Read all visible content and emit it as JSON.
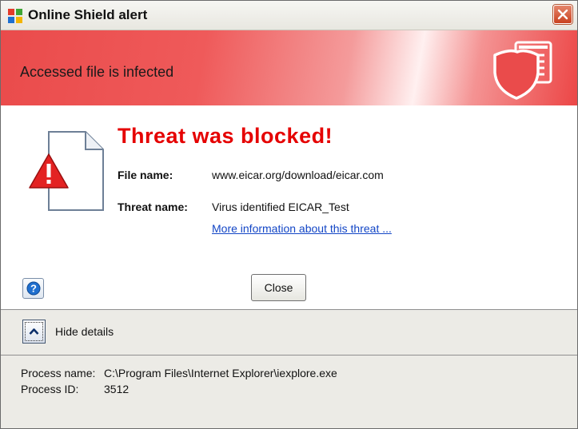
{
  "window": {
    "title": "Online Shield alert"
  },
  "header": {
    "title": "Accessed file is infected"
  },
  "main": {
    "headline": "Threat was blocked!",
    "file_name_label": "File name:",
    "file_name_value": "www.eicar.org/download/eicar.com",
    "threat_name_label": "Threat name:",
    "threat_name_value": "Virus identified EICAR_Test",
    "more_info_link": "More information about this threat ..."
  },
  "buttons": {
    "close_label": "Close"
  },
  "details": {
    "toggle_label": "Hide details",
    "process_name_label": "Process name:",
    "process_name_value": "C:\\Program Files\\Internet Explorer\\iexplore.exe",
    "process_id_label": "Process ID:",
    "process_id_value": "3512"
  },
  "icons": {
    "app": "avg-app-icon",
    "window_close": "close-icon",
    "header": "shield-icon",
    "document": "warning-document-icon",
    "help": "help-icon",
    "toggle": "chevron-up-icon"
  },
  "colors": {
    "header_red": "#ea4b4b",
    "headline_red": "#e50000",
    "link_blue": "#1346c6",
    "panel_gray": "#ecebe6"
  }
}
